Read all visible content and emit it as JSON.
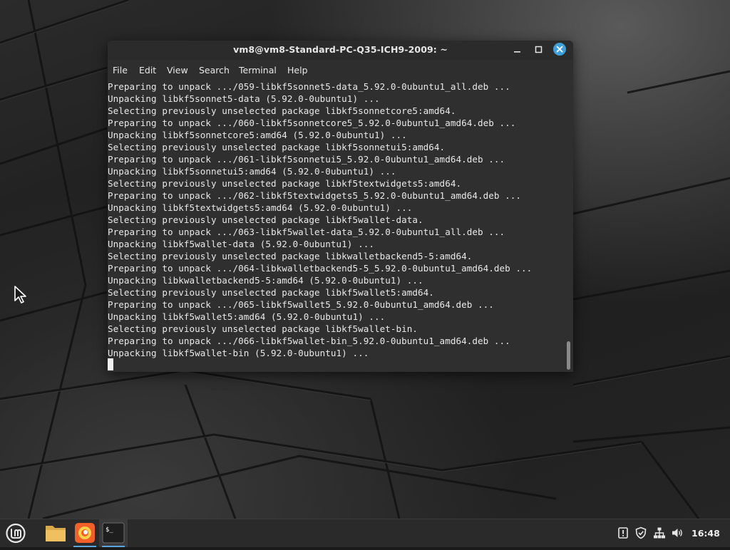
{
  "window": {
    "title": "vm8@vm8-Standard-PC-Q35-ICH9-2009: ~",
    "menu": [
      "File",
      "Edit",
      "View",
      "Search",
      "Terminal",
      "Help"
    ]
  },
  "terminal": {
    "lines": [
      "Preparing to unpack .../059-libkf5sonnet5-data_5.92.0-0ubuntu1_all.deb ...",
      "Unpacking libkf5sonnet5-data (5.92.0-0ubuntu1) ...",
      "Selecting previously unselected package libkf5sonnetcore5:amd64.",
      "Preparing to unpack .../060-libkf5sonnetcore5_5.92.0-0ubuntu1_amd64.deb ...",
      "Unpacking libkf5sonnetcore5:amd64 (5.92.0-0ubuntu1) ...",
      "Selecting previously unselected package libkf5sonnetui5:amd64.",
      "Preparing to unpack .../061-libkf5sonnetui5_5.92.0-0ubuntu1_amd64.deb ...",
      "Unpacking libkf5sonnetui5:amd64 (5.92.0-0ubuntu1) ...",
      "Selecting previously unselected package libkf5textwidgets5:amd64.",
      "Preparing to unpack .../062-libkf5textwidgets5_5.92.0-0ubuntu1_amd64.deb ...",
      "Unpacking libkf5textwidgets5:amd64 (5.92.0-0ubuntu1) ...",
      "Selecting previously unselected package libkf5wallet-data.",
      "Preparing to unpack .../063-libkf5wallet-data_5.92.0-0ubuntu1_all.deb ...",
      "Unpacking libkf5wallet-data (5.92.0-0ubuntu1) ...",
      "Selecting previously unselected package libkwalletbackend5-5:amd64.",
      "Preparing to unpack .../064-libkwalletbackend5-5_5.92.0-0ubuntu1_amd64.deb ...",
      "Unpacking libkwalletbackend5-5:amd64 (5.92.0-0ubuntu1) ...",
      "Selecting previously unselected package libkf5wallet5:amd64.",
      "Preparing to unpack .../065-libkf5wallet5_5.92.0-0ubuntu1_amd64.deb ...",
      "Unpacking libkf5wallet5:amd64 (5.92.0-0ubuntu1) ...",
      "Selecting previously unselected package libkf5wallet-bin.",
      "Preparing to unpack .../066-libkf5wallet-bin_5.92.0-0ubuntu1_amd64.deb ...",
      "Unpacking libkf5wallet-bin (5.92.0-0ubuntu1) ..."
    ]
  },
  "taskbar": {
    "menu_icon": "linux-mint-logo-icon",
    "launchers": [
      {
        "name": "file-manager-icon",
        "active": false
      },
      {
        "name": "firefox-icon",
        "active": true
      },
      {
        "name": "terminal-icon",
        "active": true
      }
    ],
    "tray": [
      "update-manager-icon",
      "shield-icon",
      "network-icon",
      "volume-icon"
    ],
    "clock": "16:48"
  },
  "colors": {
    "accent": "#3f9fd9",
    "terminal_bg": "#2f2f2f",
    "text": "#e8e8e8"
  }
}
